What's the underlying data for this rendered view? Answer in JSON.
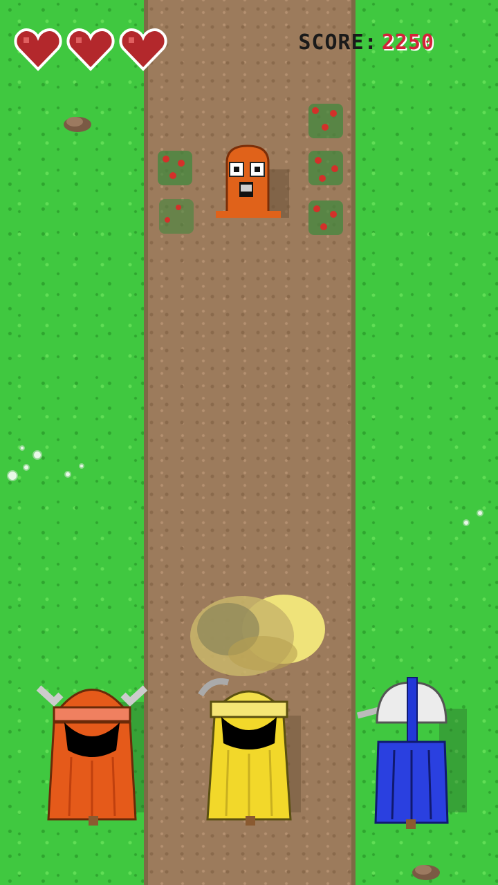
{
  "hud": {
    "lives": 3,
    "heart_icon": "heart-icon",
    "score_label": "SCORE:",
    "score_value": "2250"
  },
  "colors": {
    "grass": "#40c840",
    "road": "#9c7b5c",
    "heart": "#b3282c",
    "score_value": "#d4223a",
    "monster": "#e0621a",
    "hero_orange": "#e55a1a",
    "hero_yellow": "#f2d82a",
    "hero_blue": "#2a40e0"
  },
  "sprites": {
    "monster": "orange-blob-monster",
    "hero_left": "orange-horned-knight",
    "hero_center": "yellow-wizard-knight",
    "hero_right": "blue-caped-warrior",
    "effect": "dust-cloud"
  }
}
